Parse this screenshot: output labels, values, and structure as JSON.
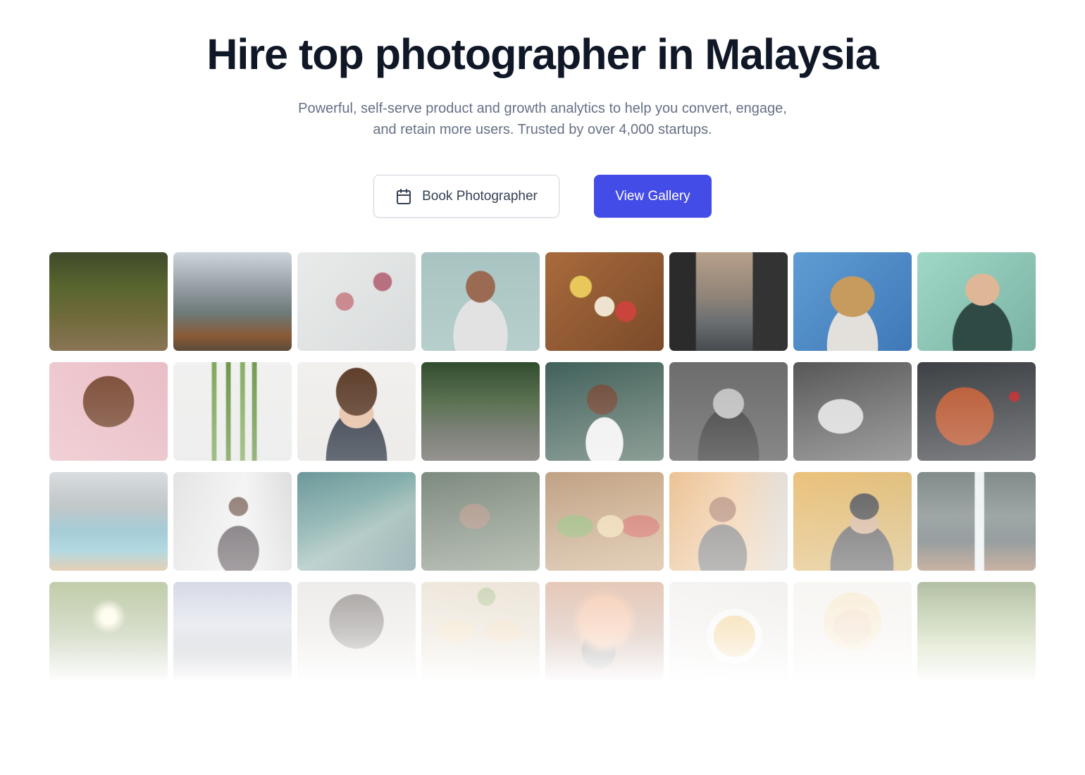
{
  "hero": {
    "title": "Hire top photographer in Malaysia",
    "subtitle_lines": [
      "Powerful, self-serve product and growth analytics to help you convert, engage,",
      "and retain more users. Trusted by over 4,000 startups."
    ]
  },
  "actions": {
    "book": {
      "label": "Book Photographer",
      "icon": "calendar-icon"
    },
    "gallery": {
      "label": "View Gallery"
    }
  },
  "colors": {
    "primary": "#444ce7",
    "heading": "#101828",
    "body_text": "#667085"
  },
  "gallery": {
    "tiles": [
      {
        "subject": "forest-path",
        "bg": "linear-gradient(180deg,#3f4a2a 0%,#58652e 35%,#6f6a3a 65%,#8a7555 100%)"
      },
      {
        "subject": "mountain-lake-boats",
        "bg": "linear-gradient(180deg,#cdd6dc 0%,#8f979c 40%,#6c7a78 62%,#8b5a36 85%,#5a4a3a 100%)"
      },
      {
        "subject": "flat-lay-flowers",
        "bg": "radial-gradient(circle at 40% 50%,#c98a90 0 10%,transparent 11%),radial-gradient(circle at 72% 30%,#b86f80 0 8%,transparent 9%),linear-gradient(135deg,#e9ebeb,#d9dcdc)"
      },
      {
        "subject": "woman-portrait-smiling",
        "bg": "radial-gradient(ellipse at 50% 35%,#9a6a52 0 17%,transparent 18%),radial-gradient(ellipse at 50% 85%,#e2e2e2 0 32%,transparent 33%),linear-gradient(180deg,#a8c4c2,#b7cfcc)"
      },
      {
        "subject": "food-platter",
        "bg": "radial-gradient(circle at 30% 35%,#e8c85a 0 10%,transparent 11%),radial-gradient(circle at 68% 60%,#c9443a 0 10%,transparent 11%),radial-gradient(circle at 50% 55%,#efe3cf 0 12%,transparent 13%),linear-gradient(135deg,#a96b3c,#7a4a2a)"
      },
      {
        "subject": "sea-cliffs-sunset",
        "bg": "linear-gradient(90deg,#2b2b2b 0 22%,transparent 23% 70%,#333 71%),linear-gradient(180deg,#b7a08a 0%,#8f8478 45%,#6b6f72 70%,#474b4f 100%)"
      },
      {
        "subject": "laughing-woman-curly-hair",
        "bg": "radial-gradient(ellipse at 50% 45%,#c79a5e 0 26%,transparent 27%),radial-gradient(ellipse at 50% 95%,#e3e0dc 0 30%,transparent 31%),linear-gradient(135deg,#5f9cd3,#3f78b8)"
      },
      {
        "subject": "man-with-glasses",
        "bg": "radial-gradient(ellipse at 55% 38%,#e0b796 0 18%,transparent 19%),radial-gradient(ellipse at 55% 90%,#2f4a44 0 32%,transparent 33%),linear-gradient(135deg,#9fd8c6,#7ab2a4)"
      },
      {
        "subject": "woman-afro-pink",
        "bg": "radial-gradient(ellipse at 50% 40%,#7a4a34 0 30%,transparent 31%),radial-gradient(ellipse at 55% 50%,#9b6a4f 0 18%,transparent 19%),linear-gradient(135deg,#efc8cf,#e6b4bd)"
      },
      {
        "subject": "asparagus",
        "bg": "linear-gradient(90deg,transparent 0 32%,#7fa65a 33% 36%,transparent 37% 44%,#6c9648 45% 48%,transparent 49% 56%,#86ad62 57% 60%,transparent 61% 66%,#72994e 67% 70%,transparent 71%),linear-gradient(180deg,#f1f1f0,#e7e9e7)"
      },
      {
        "subject": "young-man-portrait",
        "bg": "radial-gradient(ellipse at 50% 30%,#5a3a26 0 24%,transparent 25%),radial-gradient(ellipse at 50% 52%,#e6c0a4 0 20%,transparent 21%),radial-gradient(ellipse at 50% 100%,#2f3744 0 36%,transparent 37%),linear-gradient(180deg,#f2f0ee,#e8e5e2)"
      },
      {
        "subject": "forest-bridge",
        "bg": "linear-gradient(180deg,#2f4a2c 0%,#46603b 40%,#5d6457 70%,#6e6a66 100%)"
      },
      {
        "subject": "woman-white-top",
        "bg": "radial-gradient(ellipse at 48% 38%,#6a4634 0 17%,transparent 18%),radial-gradient(ellipse at 50% 82%,#f0f0f0 0 22%,transparent 23%),linear-gradient(135deg,#3f5f5a,#617a6e)"
      },
      {
        "subject": "bw-woman-portrait",
        "bg": "radial-gradient(ellipse at 50% 42%,#bdbdbd 0 18%,transparent 19%),radial-gradient(ellipse at 50% 95%,#3c3c3c 0 36%,transparent 37%),linear-gradient(180deg,#6b6b6b,#5c5c5c)"
      },
      {
        "subject": "bw-woman-profile",
        "bg": "radial-gradient(ellipse at 40% 55%,#d9d9d9 0 22%,transparent 23%),linear-gradient(135deg,#555,#7a7a7a)"
      },
      {
        "subject": "stir-fry-pan",
        "bg": "radial-gradient(circle at 40% 55%,#b8552e 0 32%,transparent 33%),radial-gradient(circle at 82% 35%,#b3232a 0 4%,transparent 5%),linear-gradient(135deg,#3b3e42,#4a4d51)"
      },
      {
        "subject": "lake-boat-mountains",
        "bg": "linear-gradient(180deg,#c9cfd2 0%,#9ba6a8 35%,#5fa4b8 60%,#6bb6c6 80%,#c59a62 100%)"
      },
      {
        "subject": "man-in-suit",
        "bg": "radial-gradient(ellipse at 55% 35%,#5a4034 0 10%,transparent 11%),radial-gradient(ellipse at 55% 80%,#3a3136 0 22%,transparent 23%),linear-gradient(90deg,#d8d8d8,#efefef 60%,#d0d0d0)"
      },
      {
        "subject": "milky-way",
        "bg": "linear-gradient(150deg,#2d6b6e 0%,#4e8a86 40%,#7aa29b 60%,#3d6c72 100%)"
      },
      {
        "subject": "woman-in-jungle",
        "bg": "radial-gradient(ellipse at 45% 45%,#8a6a58 0 16%,transparent 17%),linear-gradient(135deg,#46584a,#6a7a62)"
      },
      {
        "subject": "toast-platter",
        "bg": "radial-gradient(ellipse at 25% 55%,#7a9a4a 0 14%,transparent 15%),radial-gradient(ellipse at 55% 55%,#e3c790 0 14%,transparent 15%),radial-gradient(ellipse at 80% 55%,#c24a3a 0 14%,transparent 15%),linear-gradient(135deg,#a57a52,#c49a6a)"
      },
      {
        "subject": "woman-city-window",
        "bg": "radial-gradient(ellipse at 45% 38%,#a8755a 0 14%,transparent 15%),radial-gradient(ellipse at 45% 85%,#6e6a68 0 26%,transparent 27%),linear-gradient(90deg,#e3a868,#f0c698 55%,#d7d2cb)"
      },
      {
        "subject": "man-beanie",
        "bg": "radial-gradient(ellipse at 60% 35%,#1c1c1c 0 14%,transparent 15%),radial-gradient(ellipse at 60% 52%,#c9a07e 0 14%,transparent 15%),radial-gradient(ellipse at 58% 95%,#3a3a3a 0 32%,transparent 33%),linear-gradient(135deg,#e2a742,#caa34e)"
      },
      {
        "subject": "waterfall",
        "bg": "linear-gradient(90deg,transparent 0 48%,#e9eef0 49% 56%,transparent 57%),linear-gradient(180deg,#4c5a58 0%,#5d6b6a 45%,#3c4b4e 70%,#8a5a3a 100%)"
      },
      {
        "subject": "sunlit-trees",
        "bg": "radial-gradient(circle at 50% 35%,#fff8d0 0 8%,transparent 20%),linear-gradient(180deg,#6f8a3a,#5a7430)"
      },
      {
        "subject": "mountain-dusk",
        "bg": "linear-gradient(180deg,#9fa8c4 0%,#b9bfd2 45%,#5e6575 75%,#3e4452 100%)"
      },
      {
        "subject": "woman-afro-dark",
        "bg": "radial-gradient(ellipse at 50% 40%,#2e2520 0 32%,transparent 33%),radial-gradient(ellipse at 50% 55%,#6a4a3a 0 16%,transparent 17%),linear-gradient(180deg,#d9d4cf,#cfc9c3)"
      },
      {
        "subject": "wraps-flat-lay",
        "bg": "radial-gradient(ellipse at 30% 50%,#e3c28e 0 16%,transparent 17%),radial-gradient(ellipse at 70% 50%,#dfba85 0 16%,transparent 17%),radial-gradient(circle at 55% 15%,#8aa05a 0 8%,transparent 9%),linear-gradient(135deg,#d9c9b0,#cdbb9e)"
      },
      {
        "subject": "person-silhouette",
        "bg": "radial-gradient(ellipse at 50% 40%,#e98f5a 0 28%,transparent 40%),radial-gradient(ellipse at 45% 70%,#2a2420 0 18%,transparent 19%),linear-gradient(180deg,#c6825a,#8a5a48)"
      },
      {
        "subject": "soup-bowl",
        "bg": "radial-gradient(circle at 55% 55%,#e8b24a 0 24%,#f3f3f3 25% 32%,transparent 33%),linear-gradient(135deg,#e9e6e2,#dcd8d3)"
      },
      {
        "subject": "blonde-woman",
        "bg": "radial-gradient(ellipse at 50% 45%,#e8c49a 0 22%,transparent 23%),radial-gradient(ellipse at 50% 40%,#efd7a8 0 34%,transparent 35%),linear-gradient(180deg,#f0ebe4,#e6e0d8)"
      },
      {
        "subject": "green-moss",
        "bg": "linear-gradient(180deg,#4d6a2c 0%,#6a8a3a 40%,#8aa648 70%,#5f7d30 100%)"
      }
    ]
  }
}
